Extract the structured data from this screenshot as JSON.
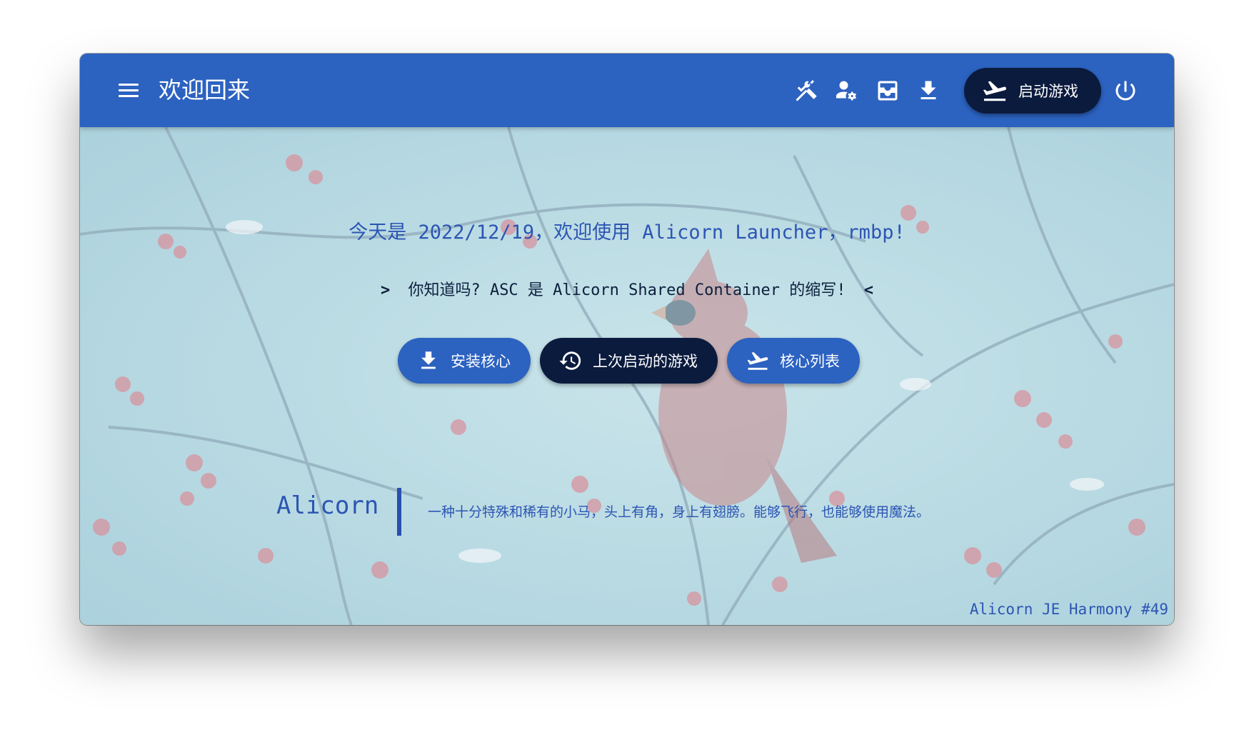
{
  "header": {
    "title": "欢迎回来",
    "launch_label": "启动游戏",
    "icons": [
      "tools-icon",
      "account-settings-icon",
      "inbox-icon",
      "download-icon",
      "airplane-takeoff-icon",
      "power-icon"
    ]
  },
  "main": {
    "welcome": "今天是 2022/12/19，欢迎使用 Alicorn Launcher，rmbp!",
    "tip_prefix": ">",
    "tip": "你知道吗? ASC 是 Alicorn Shared Container 的缩写!",
    "tip_suffix": "<",
    "buttons": {
      "install_core": "安装核心",
      "last_game": "上次启动的游戏",
      "core_list": "核心列表"
    },
    "brand": "Alicorn",
    "definition": "一种十分特殊和稀有的小马，头上有角，身上有翅膀。能够飞行，也能够使用魔法。"
  },
  "footer": {
    "version": "Alicorn JE Harmony #49"
  },
  "colors": {
    "primary": "#2c62c0",
    "dark": "#0b1b3e",
    "text_blue": "#2c55b3"
  }
}
